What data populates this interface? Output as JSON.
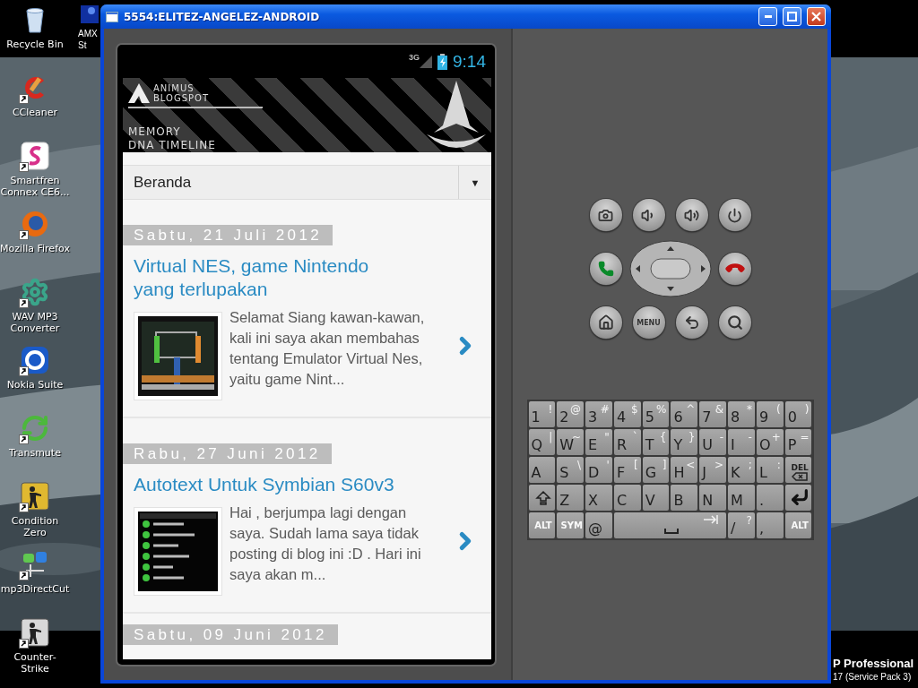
{
  "desktop": {
    "icons": [
      {
        "kind": "recycle",
        "label": "Recycle Bin",
        "shortcut": false
      },
      {
        "kind": "ccleaner",
        "label": "CCleaner",
        "shortcut": true
      },
      {
        "kind": "smartfren",
        "label": "Smartfren Connex CE6...",
        "shortcut": true
      },
      {
        "kind": "firefox",
        "label": "Mozilla Firefox",
        "shortcut": true
      },
      {
        "kind": "gear",
        "label": "WAV MP3 Converter",
        "shortcut": true
      },
      {
        "kind": "nokia",
        "label": "Nokia Suite",
        "shortcut": true
      },
      {
        "kind": "transmute",
        "label": "Transmute",
        "shortcut": true
      },
      {
        "kind": "soldier",
        "label": "Condition Zero",
        "shortcut": true
      },
      {
        "kind": "mp3",
        "label": "mp3DirectCut",
        "shortcut": true
      },
      {
        "kind": "soldier-grey",
        "label": "Counter-Strike",
        "shortcut": true
      }
    ],
    "partial_icon": {
      "label": "AMX St"
    },
    "os_version": [
      "P Professional",
      "17 (Service Pack 3)"
    ]
  },
  "window": {
    "title": "5554:ELITEZ-ANGELEZ-ANDROID"
  },
  "phone": {
    "status": {
      "network": "3G",
      "time": "9:14"
    },
    "banner": {
      "brand": [
        "ANIMUS",
        "BLOGSPOT"
      ],
      "subtitle": [
        "MEMORY",
        "DNA TIMELINE"
      ]
    },
    "dropdown": {
      "value": "Beranda",
      "arrow": "▼"
    },
    "posts": [
      {
        "date": "Sabtu, 21 Juli 2012",
        "title": "Virtual NES, game Nintendo yang terlupakan",
        "excerpt": "Selamat Siang kawan-kawan, kali ini saya akan membahas tentang Emulator Virtual Nes, yaitu game Nint...",
        "thumbnail": {
          "kind": "game"
        }
      },
      {
        "date": "Rabu, 27 Juni 2012",
        "title": "Autotext Untuk Symbian S60v3",
        "excerpt": "Hai , berjumpa lagi dengan saya. Sudah lama saya tidak posting di blog ini :D . Hari ini saya akan m...",
        "thumbnail": {
          "kind": "list"
        }
      }
    ],
    "next_date": "Sabtu, 09 Juni 2012"
  },
  "controls": {
    "menu_label": "MENU"
  },
  "keyboard": {
    "keys": [
      {
        "kind": "char",
        "main": "1",
        "alt": "!"
      },
      {
        "kind": "char",
        "main": "2",
        "alt": "@"
      },
      {
        "kind": "char",
        "main": "3",
        "alt": "#"
      },
      {
        "kind": "char",
        "main": "4",
        "alt": "$"
      },
      {
        "kind": "char",
        "main": "5",
        "alt": "%"
      },
      {
        "kind": "char",
        "main": "6",
        "alt": "^"
      },
      {
        "kind": "char",
        "main": "7",
        "alt": "&"
      },
      {
        "kind": "char",
        "main": "8",
        "alt": "*"
      },
      {
        "kind": "char",
        "main": "9",
        "alt": "("
      },
      {
        "kind": "char",
        "main": "0",
        "alt": ")"
      },
      {
        "kind": "char",
        "main": "Q",
        "alt": "|"
      },
      {
        "kind": "char",
        "main": "W",
        "alt": "~"
      },
      {
        "kind": "char",
        "main": "E",
        "alt": "\""
      },
      {
        "kind": "char",
        "main": "R",
        "alt": "`"
      },
      {
        "kind": "char",
        "main": "T",
        "alt": "{"
      },
      {
        "kind": "char",
        "main": "Y",
        "alt": "}"
      },
      {
        "kind": "char",
        "main": "U",
        "alt": "-"
      },
      {
        "kind": "char",
        "main": "I",
        "alt": "-"
      },
      {
        "kind": "char",
        "main": "O",
        "alt": "+"
      },
      {
        "kind": "char",
        "main": "P",
        "alt": "="
      },
      {
        "kind": "char",
        "main": "A"
      },
      {
        "kind": "char",
        "main": "S",
        "alt": "\\"
      },
      {
        "kind": "char",
        "main": "D",
        "alt": "'"
      },
      {
        "kind": "char",
        "main": "F",
        "alt": "["
      },
      {
        "kind": "char",
        "main": "G",
        "alt": "]"
      },
      {
        "kind": "char",
        "main": "H",
        "alt": "<"
      },
      {
        "kind": "char",
        "main": "J",
        "alt": ">"
      },
      {
        "kind": "char",
        "main": "K",
        "alt": ";"
      },
      {
        "kind": "char",
        "main": "L",
        "alt": ":"
      },
      {
        "kind": "del",
        "main": "DEL"
      },
      {
        "kind": "shift"
      },
      {
        "kind": "char",
        "main": "Z"
      },
      {
        "kind": "char",
        "main": "X"
      },
      {
        "kind": "char",
        "main": "C"
      },
      {
        "kind": "char",
        "main": "V"
      },
      {
        "kind": "char",
        "main": "B"
      },
      {
        "kind": "char",
        "main": "N"
      },
      {
        "kind": "char",
        "main": "M"
      },
      {
        "kind": "char",
        "main": "."
      },
      {
        "kind": "enter"
      },
      {
        "kind": "mod",
        "main": "ALT"
      },
      {
        "kind": "mod",
        "main": "SYM"
      },
      {
        "kind": "char",
        "main": "@"
      },
      {
        "kind": "space"
      },
      {
        "kind": "char",
        "main": "/",
        "alt": "?"
      },
      {
        "kind": "char",
        "main": ","
      },
      {
        "kind": "mod",
        "main": "ALT"
      }
    ]
  }
}
